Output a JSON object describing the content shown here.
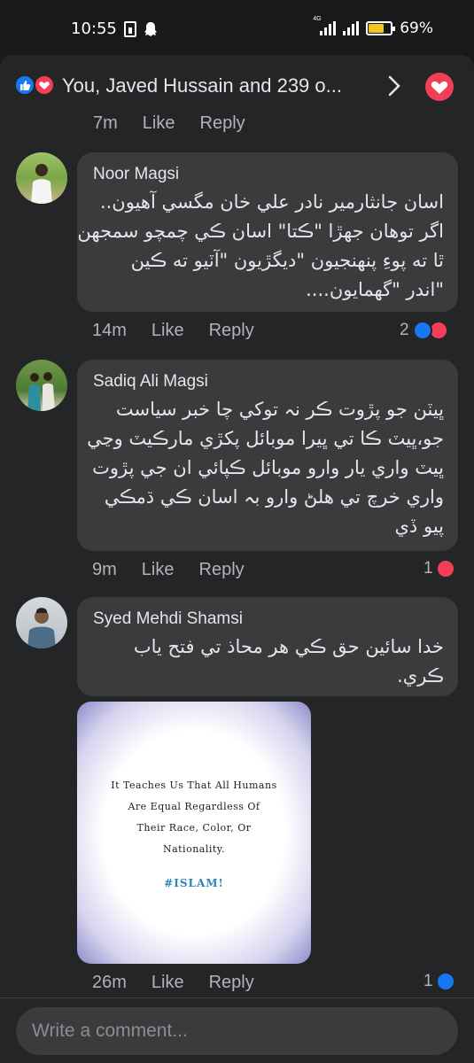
{
  "status_bar": {
    "time": "10:55",
    "network": "4G",
    "battery_percent": "69%",
    "battery_level": 0.69
  },
  "reactions_header": {
    "text": "You, Javed Hussain and 239 o..."
  },
  "top_partial": {
    "time": "7m",
    "like": "Like",
    "reply": "Reply"
  },
  "comments": [
    {
      "author": "Noor Magsi",
      "lines": [
        "اسان جانثارمير  نادر علي خان مگسي آهيون..",
        "اگر توهان جهڙا \"ڪتا\" اسان ڪي چمچو سمجهن",
        "ٿا ته پوءِ پنهنجيون \"ديگڙيون \"آٽيو ته ڪين",
        "\"اندر \"گهمايون...."
      ],
      "time": "14m",
      "like": "Like",
      "reply": "Reply",
      "reaction_count": "2"
    },
    {
      "author": "Sadiq Ali Magsi",
      "lines": [
        "ڀيٽن جو پڙوت ڪر نہ توکي چا خبر سياست",
        "جو،ڀيٽ ڪا تي ڀيرا موبائل پکڙي مارڪيٽ وڃي",
        "ڀيٽ واري يار وارو موبائل ڪپائي ان جي پڙوت",
        "واري خرچ تي هلڻ وارو بہ اسان ڪي ڌمڪي",
        "پيو ڏي"
      ],
      "time": "9m",
      "like": "Like",
      "reply": "Reply",
      "reaction_count": "1"
    },
    {
      "author": "Syed Mehdi Shamsi",
      "lines": [
        "خدا سائين حق ڪي هر محاذ تي فتح ياب",
        "ڪري."
      ],
      "time": "26m",
      "like": "Like",
      "reply": "Reply",
      "reaction_count": "1",
      "image_text": {
        "lines": [
          "It Teaches Us That All Humans",
          "Are Equal Regardless Of",
          "Their Race, Color, Or",
          "Nationality."
        ],
        "hashtag": "#ISLAM!"
      }
    }
  ],
  "composer": {
    "placeholder": "Write a comment..."
  },
  "colors": {
    "background": "#18191a",
    "sheet": "#242526",
    "bubble": "#3a3b3c",
    "like_blue": "#1877f2",
    "love_red": "#f33e58"
  },
  "icons": [
    "sim-icon",
    "snapchat-icon",
    "signal-icon",
    "battery-icon",
    "like-reaction-icon",
    "love-reaction-icon",
    "chevron-right-icon",
    "heart-button-icon"
  ]
}
